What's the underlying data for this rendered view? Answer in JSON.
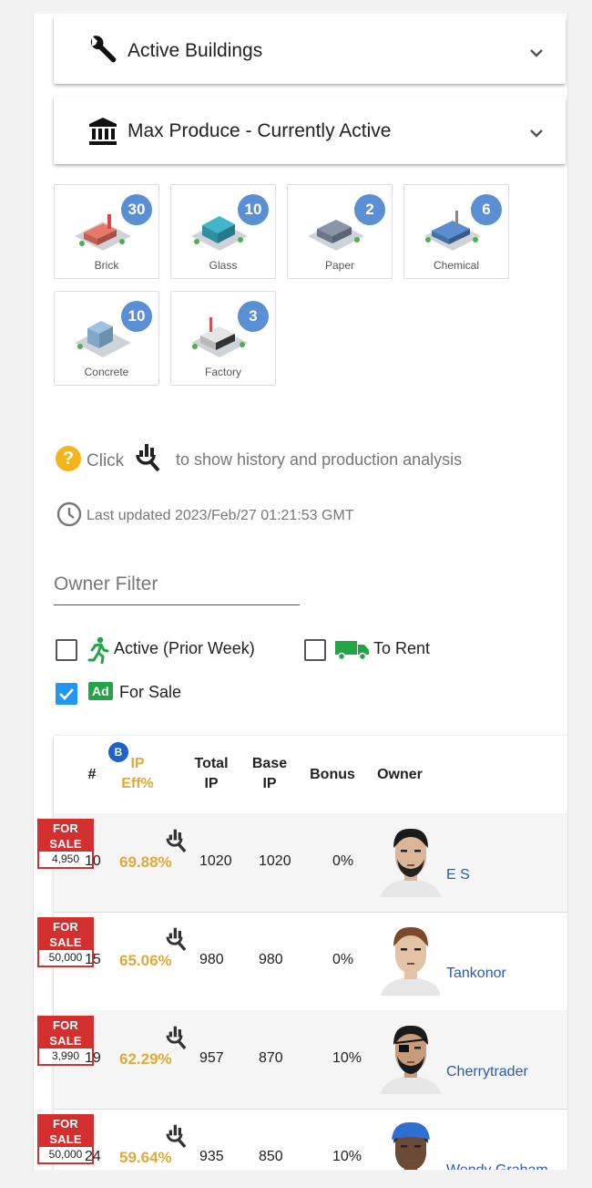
{
  "panels": [
    {
      "title": "Active Buildings",
      "icon": "wrench-icon"
    },
    {
      "title": "Max Produce - Currently Active",
      "icon": "bank-icon"
    }
  ],
  "tiles": [
    {
      "label": "Brick",
      "count": "30",
      "color": "#e8786a"
    },
    {
      "label": "Glass",
      "count": "10",
      "color": "#3fb6c9"
    },
    {
      "label": "Paper",
      "count": "2",
      "color": "#8a95a8"
    },
    {
      "label": "Chemical",
      "count": "6",
      "color": "#5a8ed0"
    },
    {
      "label": "Concrete",
      "count": "10",
      "color": "#9cc3e4"
    },
    {
      "label": "Factory",
      "count": "3",
      "color": "#b9b9b9"
    }
  ],
  "hint": {
    "icon": "help-icon",
    "click": "Click",
    "text": "to show history and production analysis"
  },
  "updated": {
    "icon": "clock-icon",
    "text": "Last updated 2023/Feb/27 01:21:53 GMT"
  },
  "filter": {
    "placeholder": "Owner Filter",
    "value": ""
  },
  "checkboxes": [
    {
      "label": "Active (Prior Week)",
      "checked": false,
      "icon": "running-person-icon"
    },
    {
      "label": "To Rent",
      "checked": false,
      "icon": "truck-icon"
    },
    {
      "label": "For Sale",
      "checked": true,
      "icon": "ad-icon",
      "icon_text": "Ad"
    }
  ],
  "table": {
    "headers": {
      "num": "#",
      "boost_badge": "B",
      "ip_eff_1": "IP",
      "ip_eff_2": "Eff%",
      "total_1": "Total",
      "total_2": "IP",
      "base_1": "Base",
      "base_2": "IP",
      "bonus": "Bonus",
      "owner": "Owner"
    },
    "sale_label": "FOR SALE",
    "rows": [
      {
        "price": "4,950",
        "num": "10",
        "eff": "69.88%",
        "total": "1020",
        "base": "1020",
        "bonus": "0%",
        "owner": "E S",
        "avatar": "dark-hair-goatee"
      },
      {
        "price": "50,000",
        "num": "15",
        "eff": "65.06%",
        "total": "980",
        "base": "980",
        "bonus": "0%",
        "owner": "Tankonor",
        "avatar": "brown-hair"
      },
      {
        "price": "3,990",
        "num": "19",
        "eff": "62.29%",
        "total": "957",
        "base": "870",
        "bonus": "10%",
        "owner": "Cherrytrader",
        "avatar": "eyepatch-beard"
      },
      {
        "price": "50,000",
        "num": "24",
        "eff": "59.64%",
        "total": "935",
        "base": "850",
        "bonus": "10%",
        "owner": "Wendy Graham",
        "avatar": "blue-cap"
      }
    ]
  },
  "colors": {
    "accent": "#2196f3",
    "badge": "#5b8fd3",
    "gold": "#e0a93a",
    "sale_red": "#d32f2f",
    "link": "#2a5bb5"
  }
}
